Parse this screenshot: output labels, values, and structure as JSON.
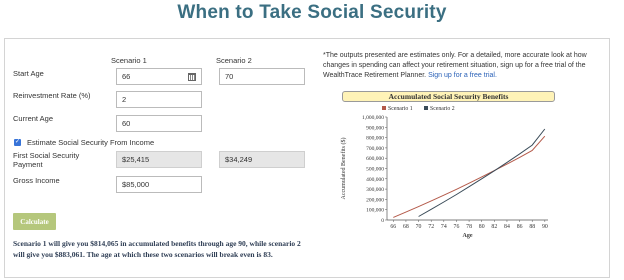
{
  "page": {
    "title": "When to Take Social Security"
  },
  "form": {
    "scenario1_header": "Scenario 1",
    "scenario2_header": "Scenario 2",
    "start_age": {
      "label": "Start Age",
      "scenario1": "66",
      "scenario2": "70"
    },
    "reinvestment_rate": {
      "label": "Reinvestment Rate (%)",
      "value": "2"
    },
    "current_age": {
      "label": "Current Age",
      "value": "60"
    },
    "estimate_checkbox": {
      "label": "Estimate Social Security From Income",
      "checked": true
    },
    "first_payment": {
      "label": "First Social Security Payment",
      "scenario1": "$25,415",
      "scenario2": "$34,249"
    },
    "gross_income": {
      "label": "Gross Income",
      "value": "$85,000"
    },
    "calculate_label": "Calculate"
  },
  "result_text": "Scenario 1 will give you $814,065 in accumulated benefits through age 90, while scenario 2 will give you $883,061. The age at which these two scenarios will break even is 83.",
  "note": {
    "text": "*The outputs presented are estimates only. For a detailed, more accurate look at how changes in spending can affect your retirement situation, sign up for a free trial of the WealthTrace Retirement Planner.",
    "link": "Sign up for a free trial."
  },
  "colors": {
    "title": "#3b6f82",
    "scenario1": "#b45a4a",
    "scenario2": "#3a4b58",
    "button": "#b5c77c"
  },
  "chart_data": {
    "type": "line",
    "title": "Accumulated Social Security Benefits",
    "xlabel": "Age",
    "ylabel": "Accumulated Benefits ($)",
    "x_ticks": [
      66,
      68,
      70,
      72,
      74,
      76,
      78,
      80,
      82,
      84,
      86,
      88,
      90
    ],
    "y_ticks": [
      0,
      100000,
      200000,
      300000,
      400000,
      500000,
      600000,
      700000,
      800000,
      900000,
      1000000
    ],
    "y_tick_labels": [
      "0",
      "100,000",
      "200,000",
      "300,000",
      "400,000",
      "500,000",
      "600,000",
      "700,000",
      "800,000",
      "900,000",
      "1,000,000"
    ],
    "xlim": [
      65,
      90.5
    ],
    "ylim": [
      0,
      1000000
    ],
    "legend_position": "top",
    "series": [
      {
        "name": "Scenario 1",
        "color": "#b45a4a",
        "x": [
          66,
          68,
          70,
          72,
          74,
          76,
          78,
          80,
          82,
          84,
          86,
          88,
          90
        ],
        "y": [
          25415,
          77000,
          130000,
          185000,
          241000,
          298000,
          357000,
          418000,
          480000,
          543000,
          608000,
          675000,
          814065
        ]
      },
      {
        "name": "Scenario 2",
        "color": "#3a4b58",
        "x": [
          70,
          72,
          74,
          76,
          78,
          80,
          82,
          84,
          86,
          88,
          90
        ],
        "y": [
          34249,
          104000,
          175000,
          248000,
          323000,
          400000,
          478000,
          559000,
          642000,
          727000,
          883061
        ]
      }
    ]
  }
}
